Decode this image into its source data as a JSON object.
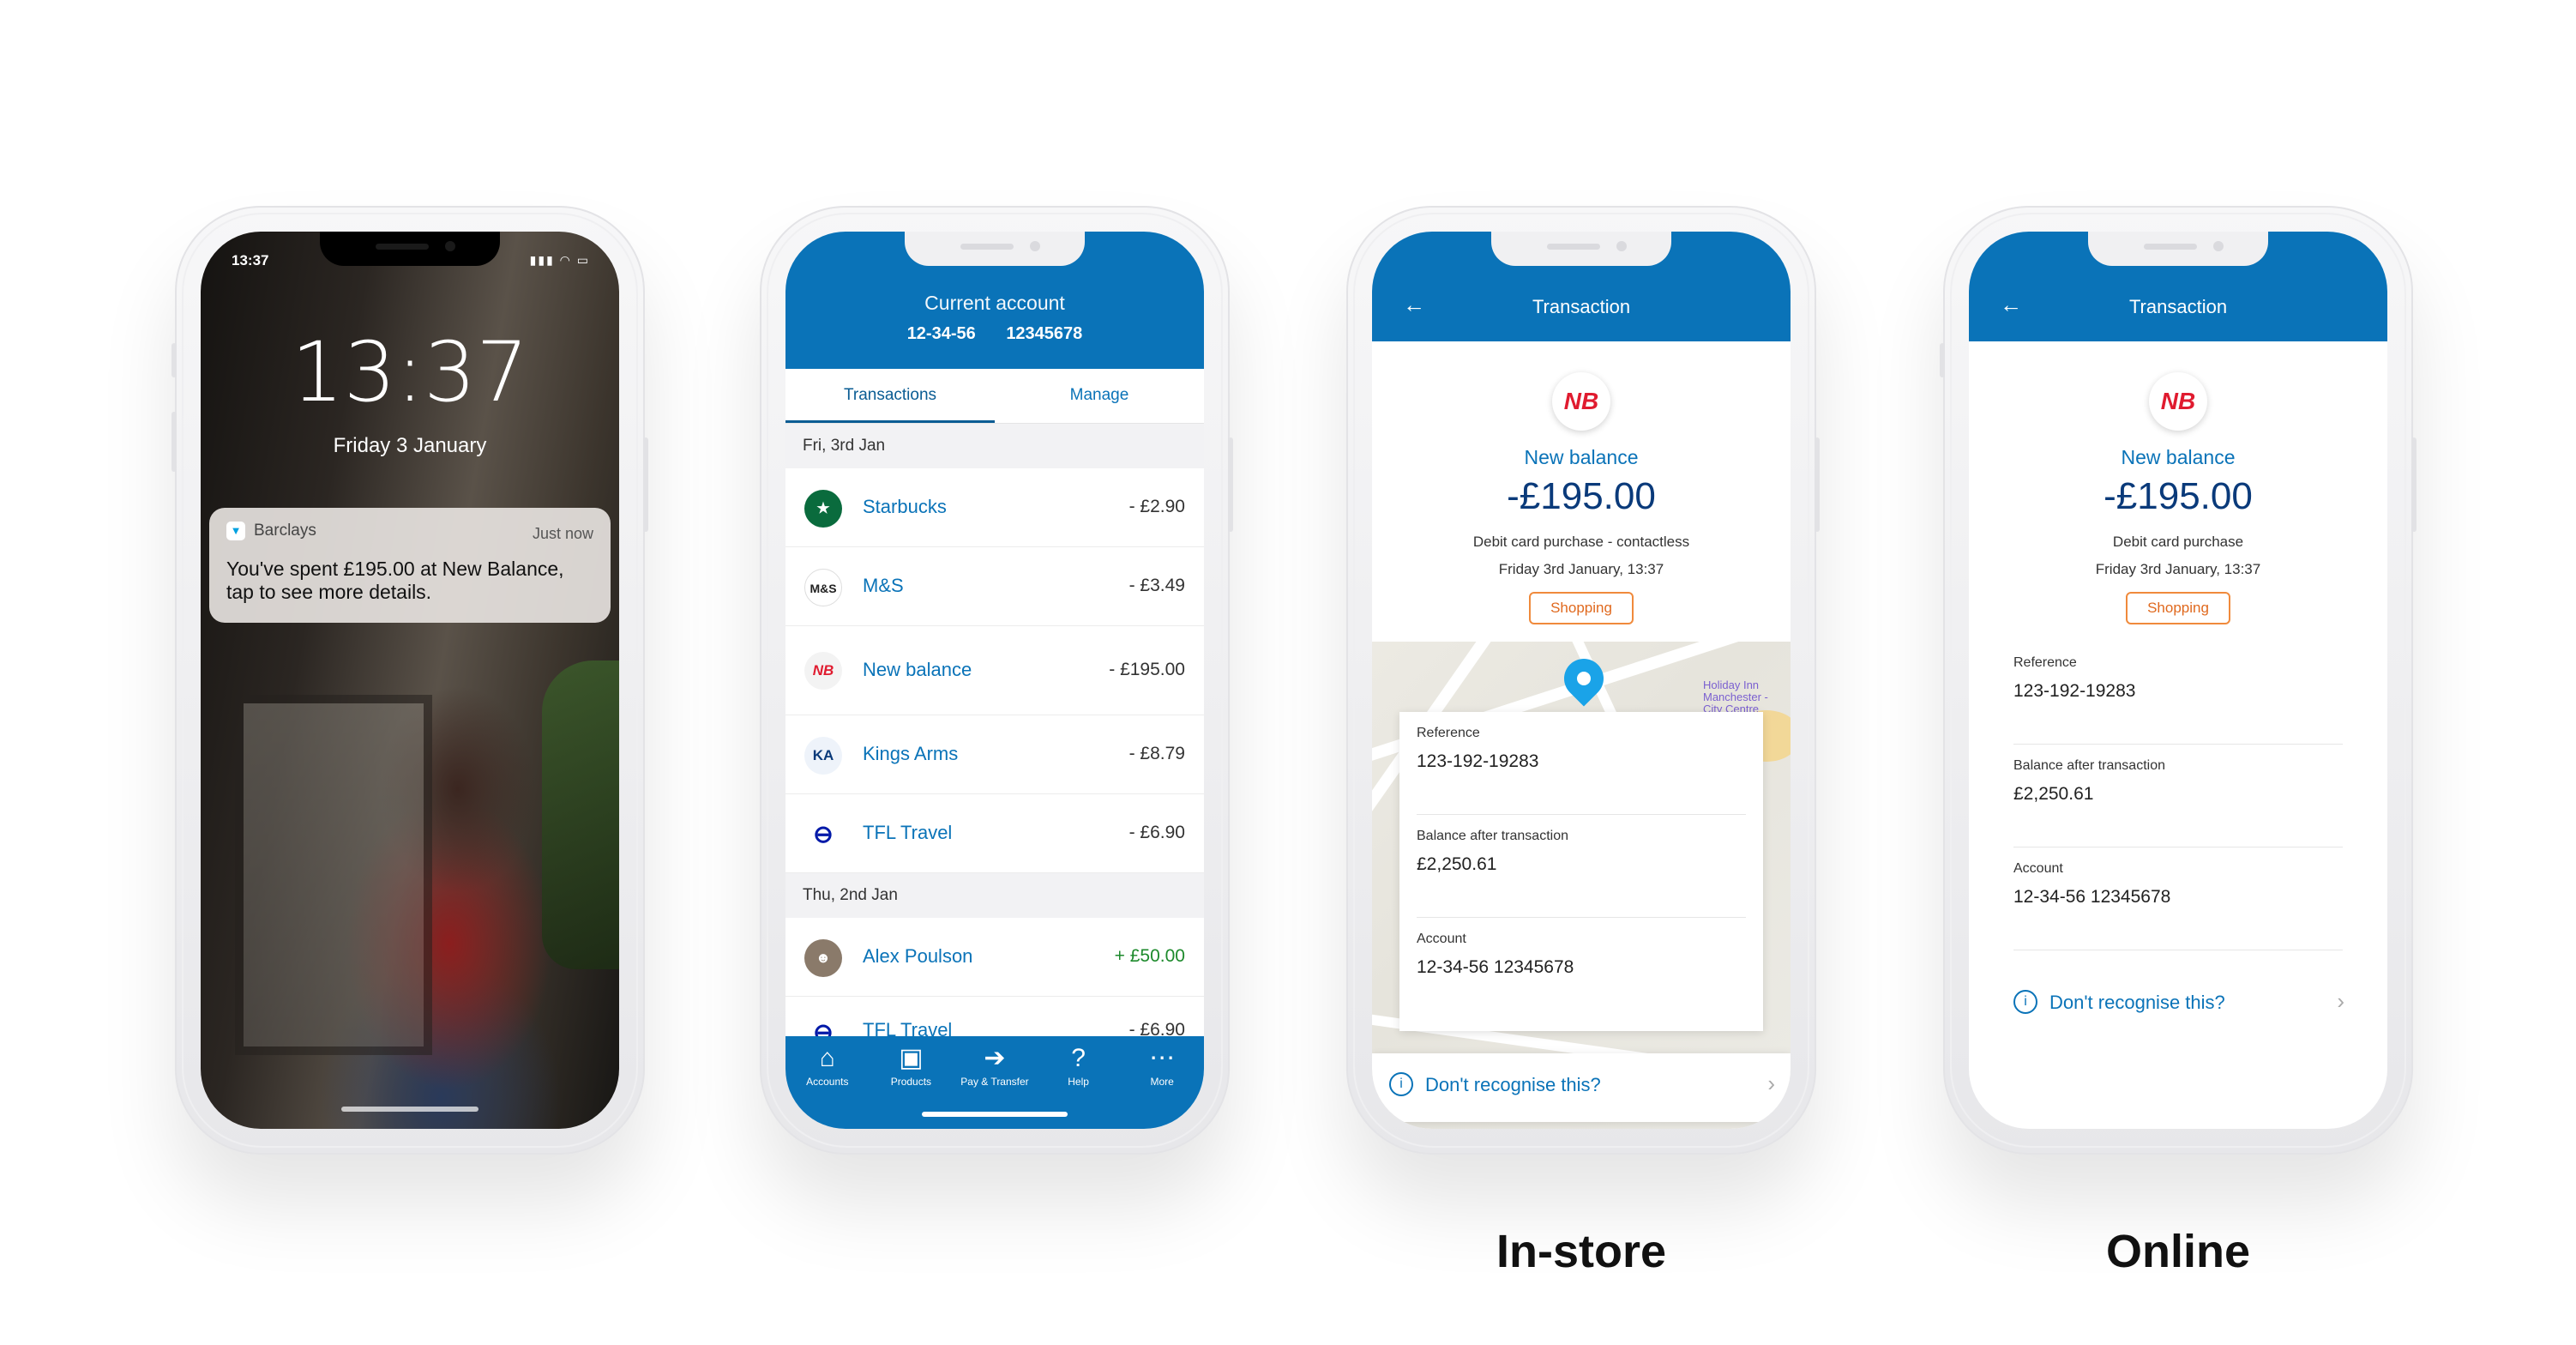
{
  "lock_screen": {
    "status_time": "13:37",
    "status_icons": "signal wifi battery",
    "clock": "13:37",
    "date": "Friday 3 January",
    "notification": {
      "app": "Barclays",
      "time": "Just now",
      "message": "You've spent £195.00 at New Balance, tap to see more details."
    }
  },
  "account_screen": {
    "title": "Current account",
    "sort_code": "12-34-56",
    "account_number": "12345678",
    "tabs": [
      "Transactions",
      "Manage"
    ],
    "sections": [
      {
        "date": "Fri, 3rd Jan",
        "transactions": [
          {
            "name": "Starbucks",
            "amount": "- £2.90",
            "icon": "starbucks-logo"
          },
          {
            "name": "M&S",
            "amount": "- £3.49",
            "icon": "ms-logo"
          },
          {
            "name": "New balance",
            "amount": "- £195.00",
            "icon": "new-balance-logo"
          },
          {
            "name": "Kings Arms",
            "amount": "- £8.79",
            "icon": "kings-arms-logo"
          },
          {
            "name": "TFL Travel",
            "amount": "- £6.90",
            "icon": "tfl-logo"
          }
        ]
      },
      {
        "date": "Thu, 2nd Jan",
        "transactions": [
          {
            "name": "Alex Poulson",
            "amount": "+ £50.00",
            "icon": "avatar"
          },
          {
            "name": "TFL Travel",
            "amount": "- £6.90",
            "icon": "tfl-logo"
          }
        ]
      }
    ],
    "tabbar": [
      "Accounts",
      "Products",
      "Pay & Transfer",
      "Help",
      "More"
    ]
  },
  "instore_screen": {
    "header": "Transaction",
    "merchant": "New balance",
    "amount": "-£195.00",
    "description": "Debit card purchase - contactless",
    "date": "Friday 3rd January, 13:37",
    "category": "Shopping",
    "map_labels": [
      "Holiday Inn Manchester - City Centre"
    ],
    "fields": [
      {
        "label": "Reference",
        "value": "123-192-19283"
      },
      {
        "label": "Balance after transaction",
        "value": "£2,250.61"
      },
      {
        "label": "Account",
        "value": "12-34-56  12345678"
      }
    ],
    "help_link": "Don't recognise this?",
    "caption": "In-store"
  },
  "online_screen": {
    "header": "Transaction",
    "merchant": "New balance",
    "amount": "-£195.00",
    "description": "Debit card purchase",
    "date": "Friday 3rd January, 13:37",
    "category": "Shopping",
    "fields": [
      {
        "label": "Reference",
        "value": "123-192-19283"
      },
      {
        "label": "Balance after transaction",
        "value": "£2,250.61"
      },
      {
        "label": "Account",
        "value": "12-34-56  12345678"
      }
    ],
    "help_link": "Don't recognise this?",
    "caption": "Online"
  },
  "colors": {
    "brand_blue": "#0a73b8",
    "navy": "#0a3a7a",
    "credit_green": "#1d8a2c",
    "category_orange": "#f08a3c",
    "new_balance_red": "#e01b2f"
  }
}
